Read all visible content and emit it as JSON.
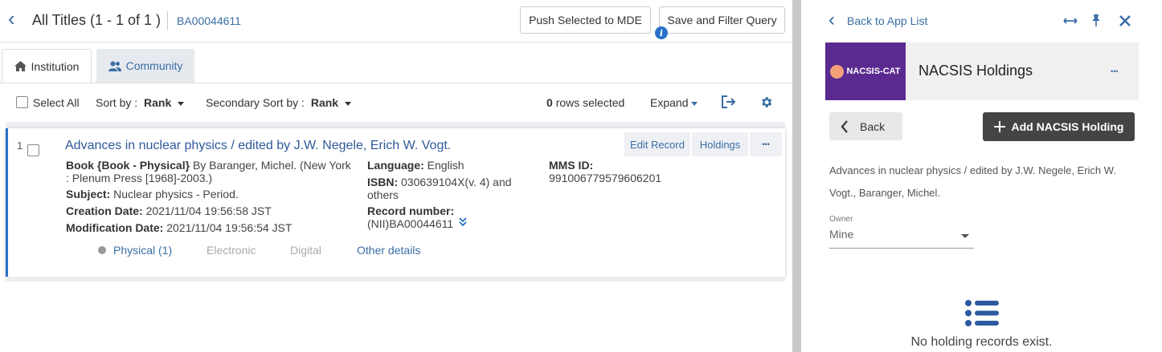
{
  "header": {
    "title": "All Titles (1 - 1 of 1 )",
    "record_id": "BA00044611",
    "push_button": "Push Selected to MDE",
    "save_button": "Save and Filter Query",
    "info_glyph": "i"
  },
  "tabs": [
    {
      "label": "Institution",
      "icon": "home-icon"
    },
    {
      "label": "Community",
      "icon": "users-icon"
    }
  ],
  "toolbar": {
    "select_all": "Select All",
    "sort_label": "Sort by :",
    "sort_value": "Rank",
    "secondary_sort_label": "Secondary Sort by :",
    "secondary_sort_value": "Rank",
    "rows_selected_count": "0",
    "rows_selected_text": "rows selected",
    "expand": "Expand"
  },
  "record": {
    "index": "1",
    "title": "Advances in nuclear physics / edited by J.W. Negele, Erich W. Vogt.",
    "actions": {
      "edit": "Edit Record",
      "holdings": "Holdings",
      "more": "•••"
    },
    "type_label": "Book {Book - Physical}",
    "type_rest_line1": "By Baranger, Michel. (New York",
    "type_rest_line2": ": Plenum Press [1968]-2003.)",
    "subject_label": "Subject:",
    "subject_value": "Nuclear physics - Period.",
    "creation_label": "Creation Date:",
    "creation_value": "2021/11/04 19:56:58 JST",
    "modification_label": "Modification Date:",
    "modification_value": "2021/11/04 19:56:54 JST",
    "language_label": "Language:",
    "language_value": "English",
    "isbn_label": "ISBN:",
    "isbn_value_line1": "030639104X(v. 4) and",
    "isbn_value_line2": "others",
    "recnum_label": "Record number:",
    "recnum_value": "(NII)BA00044611",
    "mms_label": "MMS ID:",
    "mms_value": "991006779579606201",
    "physical": "Physical (1)",
    "electronic": "Electronic",
    "digital": "Digital",
    "other_details": "Other details"
  },
  "panel": {
    "back_to_list": "Back to App List",
    "logo_text": "NACSIS-CAT",
    "title": "NACSIS Holdings",
    "more": "•••",
    "back_button": "Back",
    "add_button": "Add NACSIS Holding",
    "description_line1": "Advances in nuclear physics / edited by J.W. Negele, Erich W.",
    "description_line2": "Vogt., Baranger, Michel.",
    "owner_label": "Owner",
    "owner_value": "Mine",
    "empty_message": "No holding records exist."
  },
  "colors": {
    "accent": "#3a6ea5",
    "logo_bg": "#5b2a91",
    "dark_button": "#444444",
    "card_border": "#2870c8"
  }
}
